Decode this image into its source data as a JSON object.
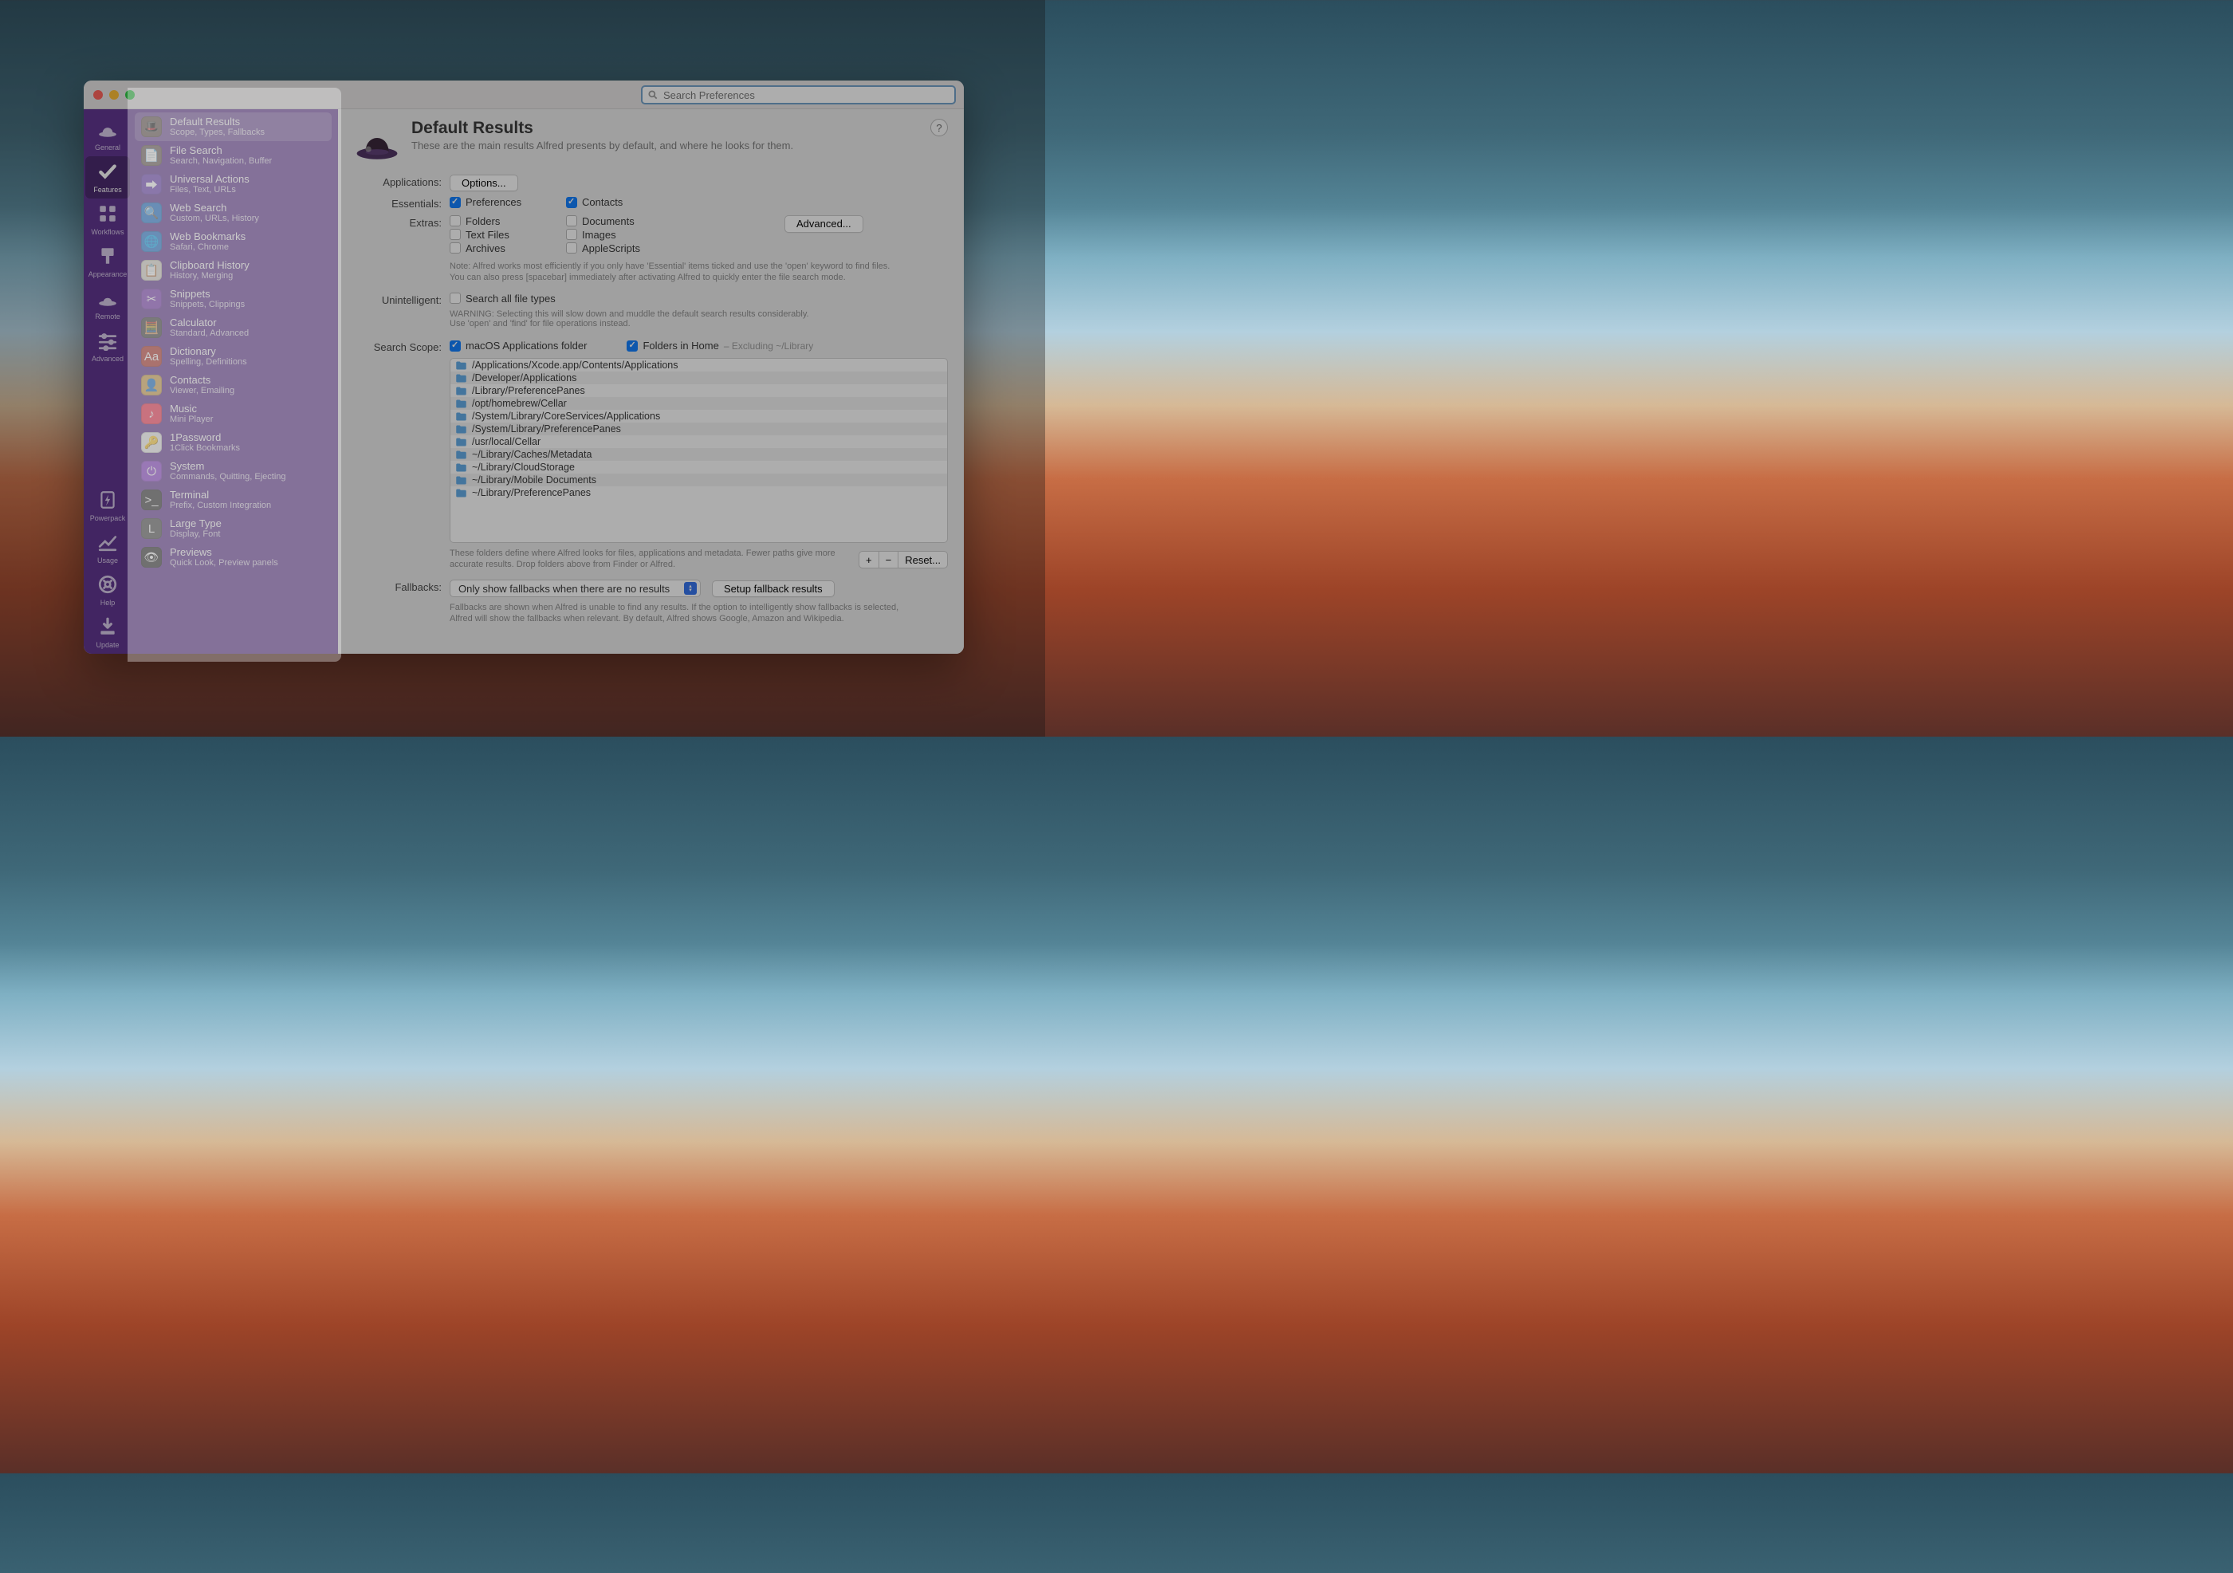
{
  "search_placeholder": "Search Preferences",
  "categories_top": [
    {
      "label": "General",
      "icon": "hat",
      "active": false
    },
    {
      "label": "Features",
      "icon": "check",
      "active": true
    },
    {
      "label": "Workflows",
      "icon": "grid",
      "active": false
    },
    {
      "label": "Appearance",
      "icon": "brush",
      "active": false
    },
    {
      "label": "Remote",
      "icon": "remote",
      "active": false
    },
    {
      "label": "Advanced",
      "icon": "sliders",
      "active": false
    }
  ],
  "categories_bottom": [
    {
      "label": "Powerpack",
      "icon": "bolt"
    },
    {
      "label": "Usage",
      "icon": "chart"
    },
    {
      "label": "Help",
      "icon": "help"
    },
    {
      "label": "Update",
      "icon": "download"
    }
  ],
  "features": [
    {
      "title": "Default Results",
      "sub": "Scope, Types, Fallbacks",
      "color": "#6d5f58",
      "glyph": "🎩",
      "active": true
    },
    {
      "title": "File Search",
      "sub": "Search, Navigation, Buffer",
      "color": "#6d5f58",
      "glyph": "📄"
    },
    {
      "title": "Universal Actions",
      "sub": "Files, Text, URLs",
      "color": "#6a3db5",
      "glyph": "⮕"
    },
    {
      "title": "Web Search",
      "sub": "Custom, URLs, History",
      "color": "#1b74d1",
      "glyph": "🔍"
    },
    {
      "title": "Web Bookmarks",
      "sub": "Safari, Chrome",
      "color": "#1b74d1",
      "glyph": "🌐"
    },
    {
      "title": "Clipboard History",
      "sub": "History, Merging",
      "color": "#d9d5c9",
      "glyph": "📋"
    },
    {
      "title": "Snippets",
      "sub": "Snippets, Clippings",
      "color": "#7a38b6",
      "glyph": "✂"
    },
    {
      "title": "Calculator",
      "sub": "Standard, Advanced",
      "color": "#444",
      "glyph": "🧮"
    },
    {
      "title": "Dictionary",
      "sub": "Spelling, Definitions",
      "color": "#b53228",
      "glyph": "Aa"
    },
    {
      "title": "Contacts",
      "sub": "Viewer, Emailing",
      "color": "#d6a34a",
      "glyph": "👤"
    },
    {
      "title": "Music",
      "sub": "Mini Player",
      "color": "#fa3150",
      "glyph": "♪"
    },
    {
      "title": "1Password",
      "sub": "1Click Bookmarks",
      "color": "#ececec",
      "glyph": "🔑"
    },
    {
      "title": "System",
      "sub": "Commands, Quitting, Ejecting",
      "color": "#8e3fd1",
      "glyph": "⏻"
    },
    {
      "title": "Terminal",
      "sub": "Prefix, Custom Integration",
      "color": "#2b2b2b",
      "glyph": ">_"
    },
    {
      "title": "Large Type",
      "sub": "Display, Font",
      "color": "#4a4a4a",
      "glyph": "L"
    },
    {
      "title": "Previews",
      "sub": "Quick Look, Preview panels",
      "color": "#2b2b2b",
      "glyph": "👁"
    }
  ],
  "page": {
    "title": "Default Results",
    "subtitle": "These are the main results Alfred presents by default, and where he looks for them.",
    "rows": {
      "applications_label": "Applications:",
      "options_btn": "Options...",
      "essentials_label": "Essentials:",
      "essentials": [
        {
          "label": "Preferences",
          "checked": true
        },
        {
          "label": "Contacts",
          "checked": true
        }
      ],
      "extras_label": "Extras:",
      "extras": [
        {
          "label": "Folders",
          "checked": false
        },
        {
          "label": "Documents",
          "checked": false
        },
        {
          "label": "Text Files",
          "checked": false
        },
        {
          "label": "Images",
          "checked": false
        },
        {
          "label": "Archives",
          "checked": false
        },
        {
          "label": "AppleScripts",
          "checked": false
        }
      ],
      "advanced_btn": "Advanced...",
      "extras_note1": "Note: Alfred works most efficiently if you only have 'Essential' items ticked and use the 'open' keyword to find files.",
      "extras_note2": "You can also press [spacebar] immediately after activating Alfred to quickly enter the file search mode.",
      "unintelligent_label": "Unintelligent:",
      "search_all_label": "Search all file types",
      "search_all_checked": false,
      "unint_warn1": "WARNING: Selecting this will slow down and muddle the default search results considerably.",
      "unint_warn2": "Use 'open' and 'find' for file operations instead.",
      "scope_label": "Search Scope:",
      "scope_cb1": {
        "label": "macOS Applications folder",
        "checked": true
      },
      "scope_cb2": {
        "label": "Folders in Home",
        "checked": true,
        "suffix": "– Excluding ~/Library"
      },
      "scope_paths": [
        "/Applications/Xcode.app/Contents/Applications",
        "/Developer/Applications",
        "/Library/PreferencePanes",
        "/opt/homebrew/Cellar",
        "/System/Library/CoreServices/Applications",
        "/System/Library/PreferencePanes",
        "/usr/local/Cellar",
        "~/Library/Caches/Metadata",
        "~/Library/CloudStorage",
        "~/Library/Mobile Documents",
        "~/Library/PreferencePanes"
      ],
      "scope_note1": "These folders define where Alfred looks for files, applications and metadata. Fewer paths give more accurate results. Drop folders above from Finder or Alfred.",
      "add_btn": "+",
      "rem_btn": "−",
      "reset_btn": "Reset...",
      "fallbacks_label": "Fallbacks:",
      "fallbacks_select": "Only show fallbacks when there are no results",
      "setup_fallbacks_btn": "Setup fallback results",
      "fallbacks_note": "Fallbacks are shown when Alfred is unable to find any results. If the option to intelligently show fallbacks is selected, Alfred will show the fallbacks when relevant. By default, Alfred shows Google, Amazon and Wikipedia."
    }
  }
}
